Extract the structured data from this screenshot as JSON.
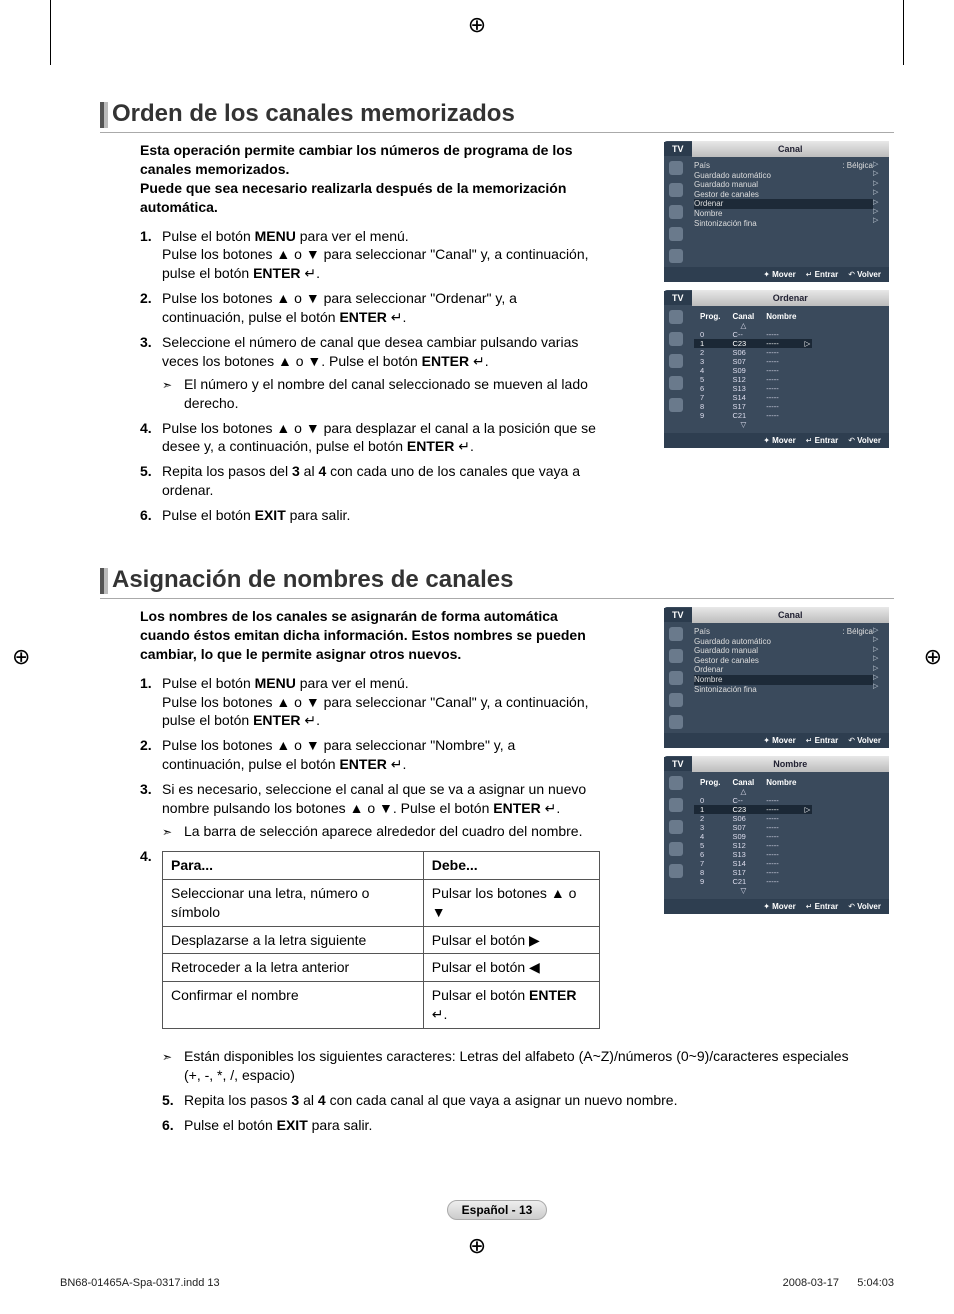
{
  "glyph": {
    "up": "▲",
    "down": "▼",
    "left": "◀",
    "right": "▶",
    "enter": "↵",
    "sub": "➣"
  },
  "printmarks": {
    "cross": "⊕"
  },
  "section1": {
    "title": "Orden de los canales memorizados",
    "intro": "Esta operación permite cambiar los números de programa de los canales memorizados.\nPuede que sea necesario realizarla después de la memorización automática.",
    "steps": [
      {
        "n": "1.",
        "t": "Pulse el botón <b>MENU</b> para ver el menú.<br>Pulse los botones ▲ o ▼ para seleccionar \"Canal\" y, a continuación, pulse el botón <b>ENTER</b> ↵."
      },
      {
        "n": "2.",
        "t": "Pulse los botones ▲ o ▼ para seleccionar \"Ordenar\" y, a continuación, pulse el botón <b>ENTER</b> ↵."
      },
      {
        "n": "3.",
        "t": "Seleccione el número de canal que desea cambiar pulsando varias veces los botones ▲ o ▼. Pulse el botón <b>ENTER</b> ↵.",
        "sub": "El número y el nombre del canal seleccionado se mueven al lado derecho."
      },
      {
        "n": "4.",
        "t": "Pulse los botones ▲ o ▼ para desplazar el canal a la posición que se desee y, a continuación, pulse el botón <b>ENTER</b> ↵."
      },
      {
        "n": "5.",
        "t": "Repita los pasos del <b>3</b> al <b>4</b> con cada uno de los canales que vaya a ordenar."
      },
      {
        "n": "6.",
        "t": "Pulse el botón <b>EXIT</b> para salir."
      }
    ]
  },
  "section2": {
    "title": "Asignación de nombres de canales",
    "intro": "Los nombres de los canales se asignarán de forma automática cuando éstos emitan dicha información. Estos nombres se pueden cambiar, lo que le permite asignar otros nuevos.",
    "steps": [
      {
        "n": "1.",
        "t": "Pulse el botón <b>MENU</b> para ver el menú.<br>Pulse los botones ▲ o ▼ para seleccionar \"Canal\" y, a continuación, pulse el botón <b>ENTER</b> ↵."
      },
      {
        "n": "2.",
        "t": "Pulse los botones ▲ o ▼ para seleccionar \"Nombre\" y, a continuación, pulse el botón <b>ENTER</b> ↵."
      },
      {
        "n": "3.",
        "t": "Si es necesario, seleccione el canal al que se va a asignar un nuevo nombre pulsando los botones ▲ o ▼. Pulse el botón <b>ENTER</b> ↵.",
        "sub": "La barra de selección aparece alrededor del cuadro del nombre."
      }
    ],
    "step4num": "4.",
    "table": {
      "head": [
        "Para...",
        "Debe..."
      ],
      "rows": [
        [
          "Seleccionar una letra, número o símbolo",
          "Pulsar los botones ▲ o ▼"
        ],
        [
          "Desplazarse a la letra siguiente",
          "Pulsar el botón ▶"
        ],
        [
          "Retroceder a la letra anterior",
          "Pulsar el botón ◀"
        ],
        [
          "Confirmar el nombre",
          "Pulsar el botón <b>ENTER</b> ↵."
        ]
      ]
    },
    "note": "Están disponibles los siguientes caracteres: Letras del alfabeto (A~Z)/números (0~9)/caracteres especiales (+, -, *, /, espacio)",
    "post": [
      {
        "n": "5.",
        "t": "Repita los pasos <b>3</b> al <b>4</b> con cada canal al que vaya a asignar un nuevo nombre."
      },
      {
        "n": "6.",
        "t": "Pulse el botón <b>EXIT</b> para salir."
      }
    ]
  },
  "osd": {
    "tab": "TV",
    "foot": {
      "move": "Mover",
      "enter": "Entrar",
      "back": "Volver",
      "moveSym": "✦",
      "enterSym": "↵",
      "backSym": "↶"
    },
    "menu1": {
      "title": "Canal",
      "items": [
        {
          "l": "País",
          "r": ": Bélgica"
        },
        {
          "l": "Guardado automático",
          "r": ""
        },
        {
          "l": "Guardado manual",
          "r": ""
        },
        {
          "l": "Gestor de canales",
          "r": ""
        },
        {
          "l": "Ordenar",
          "r": "",
          "hl": true
        },
        {
          "l": "Nombre",
          "r": ""
        },
        {
          "l": "Sintonización fina",
          "r": ""
        }
      ]
    },
    "menu1b": {
      "title": "Canal",
      "items": [
        {
          "l": "País",
          "r": ": Bélgica"
        },
        {
          "l": "Guardado automático",
          "r": ""
        },
        {
          "l": "Guardado manual",
          "r": ""
        },
        {
          "l": "Gestor de canales",
          "r": ""
        },
        {
          "l": "Ordenar",
          "r": ""
        },
        {
          "l": "Nombre",
          "r": "",
          "hl": true
        },
        {
          "l": "Sintonización fina",
          "r": ""
        }
      ]
    },
    "list1": {
      "title": "Ordenar",
      "cols": [
        "Prog.",
        "Canal",
        "Nombre"
      ],
      "rows": [
        [
          "0",
          "C--",
          "-----"
        ],
        [
          "1",
          "C23",
          "-----",
          "sel"
        ],
        [
          "2",
          "S06",
          "-----"
        ],
        [
          "3",
          "S07",
          "-----"
        ],
        [
          "4",
          "S09",
          "-----"
        ],
        [
          "5",
          "S12",
          "-----"
        ],
        [
          "6",
          "S13",
          "-----"
        ],
        [
          "7",
          "S14",
          "-----"
        ],
        [
          "8",
          "S17",
          "-----"
        ],
        [
          "9",
          "C21",
          "-----"
        ]
      ]
    },
    "list2": {
      "title": "Nombre",
      "cols": [
        "Prog.",
        "Canal",
        "Nombre"
      ],
      "rows": [
        [
          "0",
          "C--",
          "-----"
        ],
        [
          "1",
          "C23",
          "-----",
          "sel"
        ],
        [
          "2",
          "S06",
          "-----"
        ],
        [
          "3",
          "S07",
          "-----"
        ],
        [
          "4",
          "S09",
          "-----"
        ],
        [
          "5",
          "S12",
          "-----"
        ],
        [
          "6",
          "S13",
          "-----"
        ],
        [
          "7",
          "S14",
          "-----"
        ],
        [
          "8",
          "S17",
          "-----"
        ],
        [
          "9",
          "C21",
          "-----"
        ]
      ]
    }
  },
  "pagebadge": "Español - 13",
  "footer": {
    "l": "BN68-01465A-Spa-0317.indd   13",
    "r": "2008-03-17      5:04:03"
  }
}
